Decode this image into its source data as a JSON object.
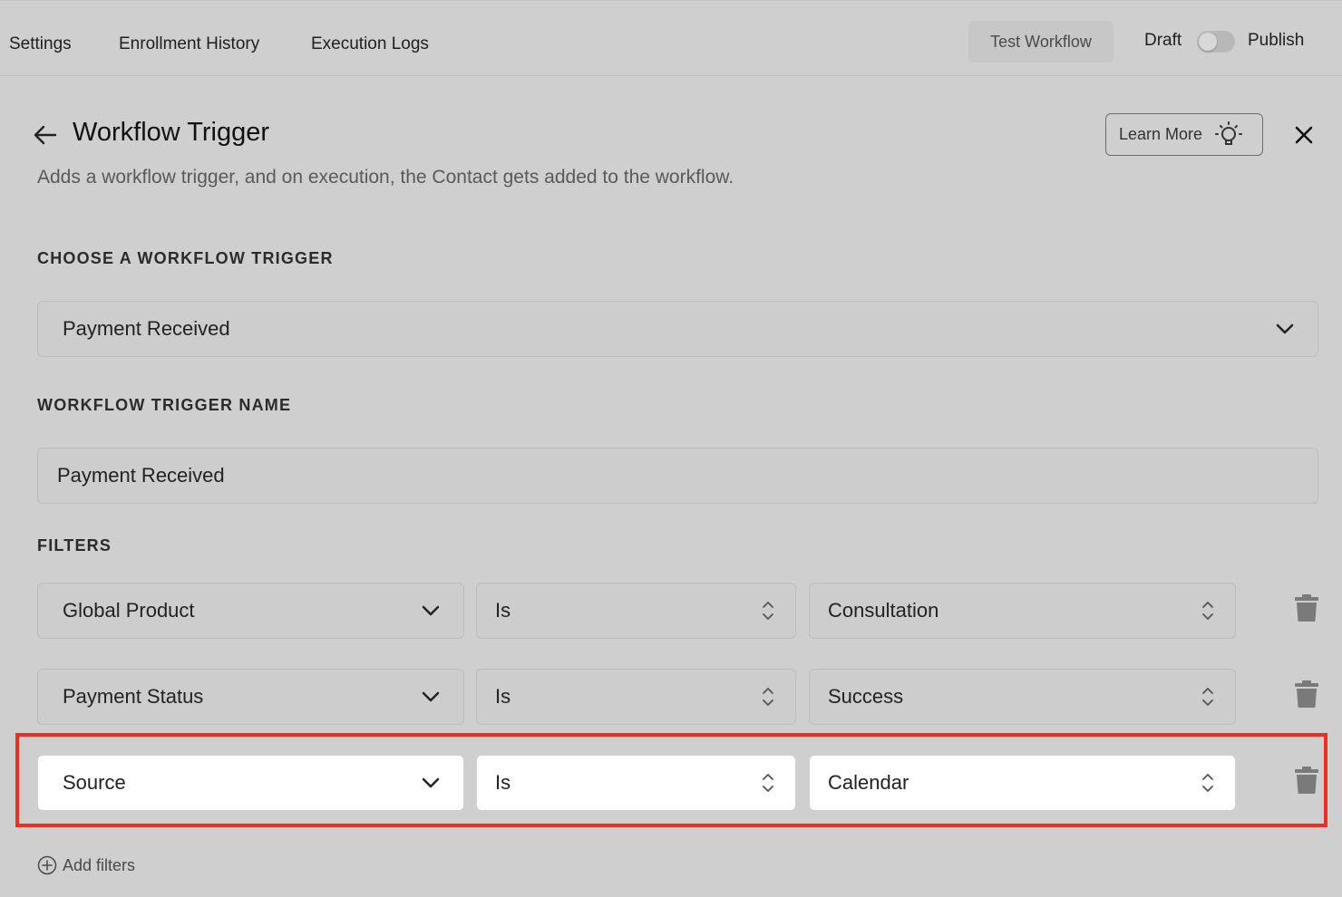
{
  "nav": {
    "tabs": [
      "Settings",
      "Enrollment History",
      "Execution Logs"
    ],
    "test_workflow": "Test Workflow",
    "draft": "Draft",
    "publish": "Publish"
  },
  "panel": {
    "title": "Workflow Trigger",
    "description": "Adds a workflow trigger, and on execution, the Contact gets added to the workflow.",
    "learn_more": "Learn More"
  },
  "trigger": {
    "section_label": "CHOOSE A WORKFLOW TRIGGER",
    "selected": "Payment Received"
  },
  "trigger_name": {
    "section_label": "WORKFLOW TRIGGER NAME",
    "value": "Payment Received"
  },
  "filters": {
    "section_label": "FILTERS",
    "rows": [
      {
        "field": "Global Product",
        "operator": "Is",
        "value": "Consultation"
      },
      {
        "field": "Payment Status",
        "operator": "Is",
        "value": "Success"
      },
      {
        "field": "Source",
        "operator": "Is",
        "value": "Calendar"
      }
    ],
    "add_label": "Add filters"
  },
  "colors": {
    "highlight": "#ee2d23",
    "background": "#cfcfcf"
  }
}
